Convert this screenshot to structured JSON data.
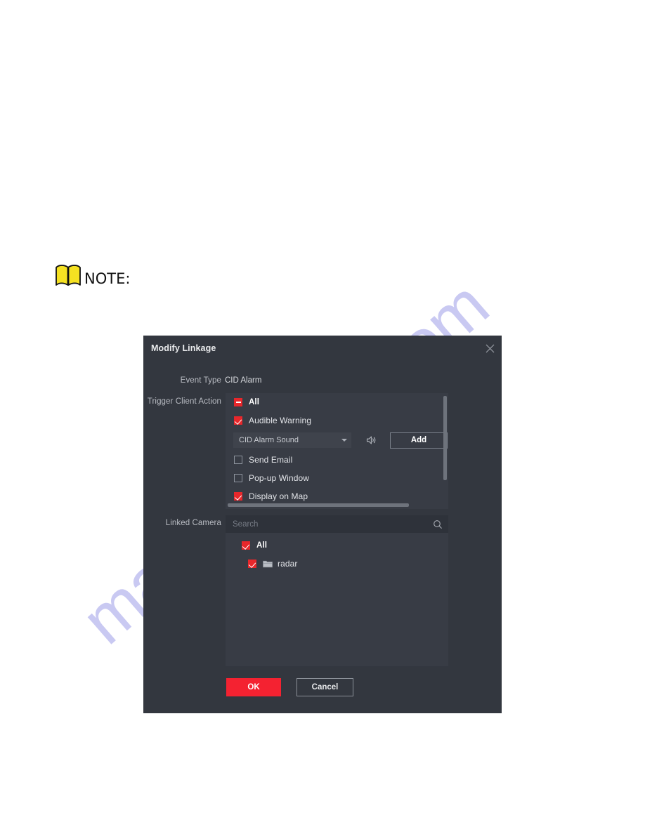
{
  "page": {
    "watermark_text": "manualshive.com",
    "note_label": "NOTE:",
    "note_icon": "yellow-book-icon"
  },
  "dialog": {
    "title": "Modify Linkage",
    "close_icon": "close-icon",
    "event_type": {
      "label": "Event Type",
      "value": "CID Alarm"
    },
    "trigger_client_action": {
      "label": "Trigger Client Action",
      "items": [
        {
          "label": "All",
          "state": "indeterminate",
          "bold": true
        },
        {
          "label": "Audible Warning",
          "state": "checked",
          "bold": false
        },
        {
          "label": "Send Email",
          "state": "unchecked",
          "bold": false
        },
        {
          "label": "Pop-up Window",
          "state": "unchecked",
          "bold": false
        },
        {
          "label": "Display on Map",
          "state": "checked",
          "bold": false
        }
      ],
      "sound": {
        "selected": "CID Alarm Sound",
        "dropdown_icon": "chevron-down-icon",
        "speaker_icon": "speaker-icon",
        "add_label": "Add"
      },
      "vertical_scrollbar": "visible",
      "horizontal_scrollbar": "visible"
    },
    "linked_camera": {
      "label": "Linked Camera",
      "search_placeholder": "Search",
      "search_value": "",
      "search_icon": "search-icon",
      "tree": [
        {
          "label": "All",
          "state": "checked",
          "level": 0,
          "bold": true,
          "icon": null
        },
        {
          "label": "radar",
          "state": "checked",
          "level": 1,
          "bold": false,
          "icon": "folder-icon"
        }
      ]
    },
    "footer": {
      "ok_label": "OK",
      "cancel_label": "Cancel"
    },
    "colors": {
      "accent_red": "#f42231",
      "checkbox_red": "#e8272b",
      "dialog_bg": "#33373f",
      "panel_bg": "#383c45",
      "search_bg": "#2e323a"
    }
  }
}
